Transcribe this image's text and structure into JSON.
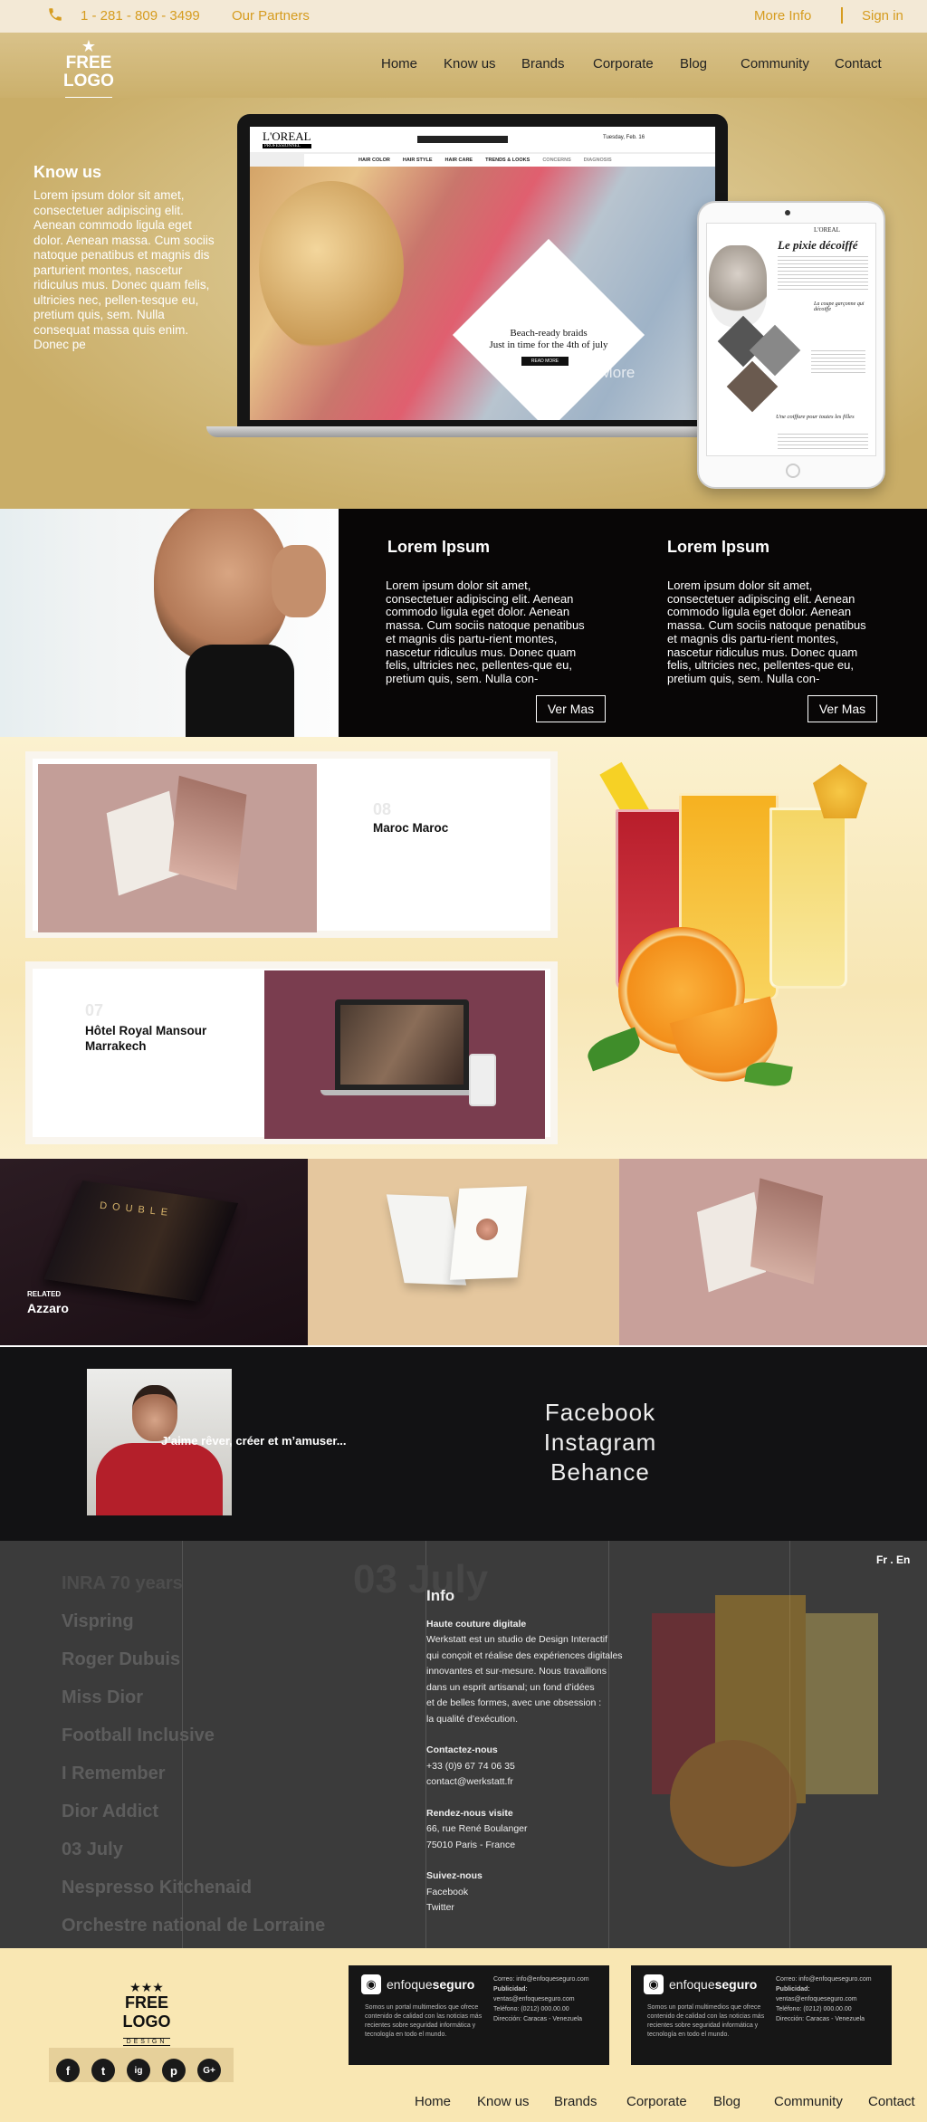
{
  "topbar": {
    "phone": "1 - 281 - 809 - 3499",
    "partners": "Our Partners",
    "more_info": "More Info",
    "sign_in": "Sign in"
  },
  "logo": {
    "title": "FREE LOGO",
    "subtitle": "DESIGN"
  },
  "nav": [
    "Home",
    "Know us",
    "Brands",
    "Corporate",
    "Blog",
    "Community",
    "Contact"
  ],
  "hero": {
    "title": "Know us",
    "text": "Lorem ipsum dolor sit amet, consectetuer adipiscing elit. Aenean commodo ligula eget dolor. Aenean massa. Cum sociis natoque penatibus et magnis dis parturient montes, nascetur ridiculus mus. Donec quam felis, ultricies nec, pellen-tesque eu, pretium quis, sem. Nulla consequat massa quis enim. Donec pe",
    "more": "+ More",
    "laptop": {
      "brand": "L'OREAL",
      "brand_sub": "PROFESSIONNEL",
      "menu": [
        "HAIR COLOR",
        "HAIR STYLE",
        "HAIR CARE",
        "TRENDS & LOOKS",
        "CONCERNS",
        "DIAGNOSIS"
      ],
      "promo_line1": "Beach-ready braids",
      "promo_line2": "Just in time for the 4th of july",
      "read_more": "READ MORE",
      "date": "Tuesday, Feb. 16"
    },
    "tablet": {
      "title": "Le pixie décoiffé",
      "sub1": "La coupe garçonne qui décoiffe",
      "sub2": "Une coiffure pour toutes les filles",
      "brand": "L'OREAL"
    }
  },
  "band": {
    "col1_title": "Lorem Ipsum",
    "col1_text": "Lorem ipsum dolor sit amet, consectetuer adipiscing elit. Aenean commodo ligula eget dolor. Aenean massa. Cum sociis natoque penatibus et magnis dis partu-rient montes, nascetur ridiculus mus. Donec quam felis, ultricies nec, pellentes-que eu, pretium quis, sem. Nulla con-",
    "col2_title": "Lorem Ipsum",
    "col2_text": "Lorem ipsum dolor sit amet, consectetuer adipiscing elit. Aenean commodo ligula eget dolor. Aenean massa. Cum sociis natoque penatibus et magnis dis partu-rient montes, nascetur ridiculus mus. Donec quam felis, ultricies nec, pellentes-que eu, pretium quis, sem. Nulla con-",
    "button": "Ver Mas"
  },
  "projects": [
    {
      "number": "08",
      "title": "Maroc Maroc"
    },
    {
      "number": "07",
      "title": "Hôtel Royal Mansour Marrakech"
    }
  ],
  "related": {
    "label": "RELATED",
    "title": "Azzaro",
    "book_title": "DOUBLE"
  },
  "profile": {
    "quote": "J’aime rêver, créer et m’amuser...",
    "links": [
      "Facebook",
      "Instagram",
      "Behance"
    ]
  },
  "info": {
    "list": [
      "INRA 70 years",
      "Vispring",
      "Roger Dubuis",
      "Miss Dior",
      "Football Inclusive",
      "I Remember",
      "Dior Addict",
      "03 July",
      "Nespresso Kitchenaid",
      "Orchestre national de Lorraine"
    ],
    "watermark": "03 July",
    "lang": "Fr . En",
    "title": "Info",
    "h1": "Haute couture digitale",
    "p1": [
      "Werkstatt est un studio de Design Interactif",
      "qui conçoit et réalise des expériences digitales",
      "innovantes et sur-mesure. Nous travaillons",
      "dans un esprit artisanal; un fond d’idées",
      "et de belles formes, avec une obsession :",
      "la qualité d’exécution."
    ],
    "h2": "Contactez-nous",
    "p2": [
      "+33 (0)9 67 74 06 35",
      "contact@werkstatt.fr"
    ],
    "h3": "Rendez-nous visite",
    "p3": [
      "66, rue René Boulanger",
      "75010 Paris - France"
    ],
    "h4": "Suivez-nous",
    "p4": [
      "Facebook",
      "Twitter"
    ]
  },
  "footer": {
    "social": [
      "f",
      "t",
      "ig",
      "p",
      "G+"
    ],
    "ad": {
      "brand_a": "enfoque",
      "brand_b": "seguro",
      "body": "Somos un portal multimedios que ofrece contenido de calidad con las noticias más recientes sobre seguridad informática y tecnología en todo el mundo.",
      "correo": "Correo: info@enfoqueseguro.com",
      "publicidad": "Publicidad:",
      "publicidad_mail": "ventas@enfoqueseguro.com",
      "telefono": "Teléfono: (0212) 000.00.00",
      "direccion": "Dirección: Caracas - Venezuela"
    },
    "nav": [
      "Home",
      "Know us",
      "Brands",
      "Corporate",
      "Blog",
      "Community",
      "Contact"
    ]
  }
}
